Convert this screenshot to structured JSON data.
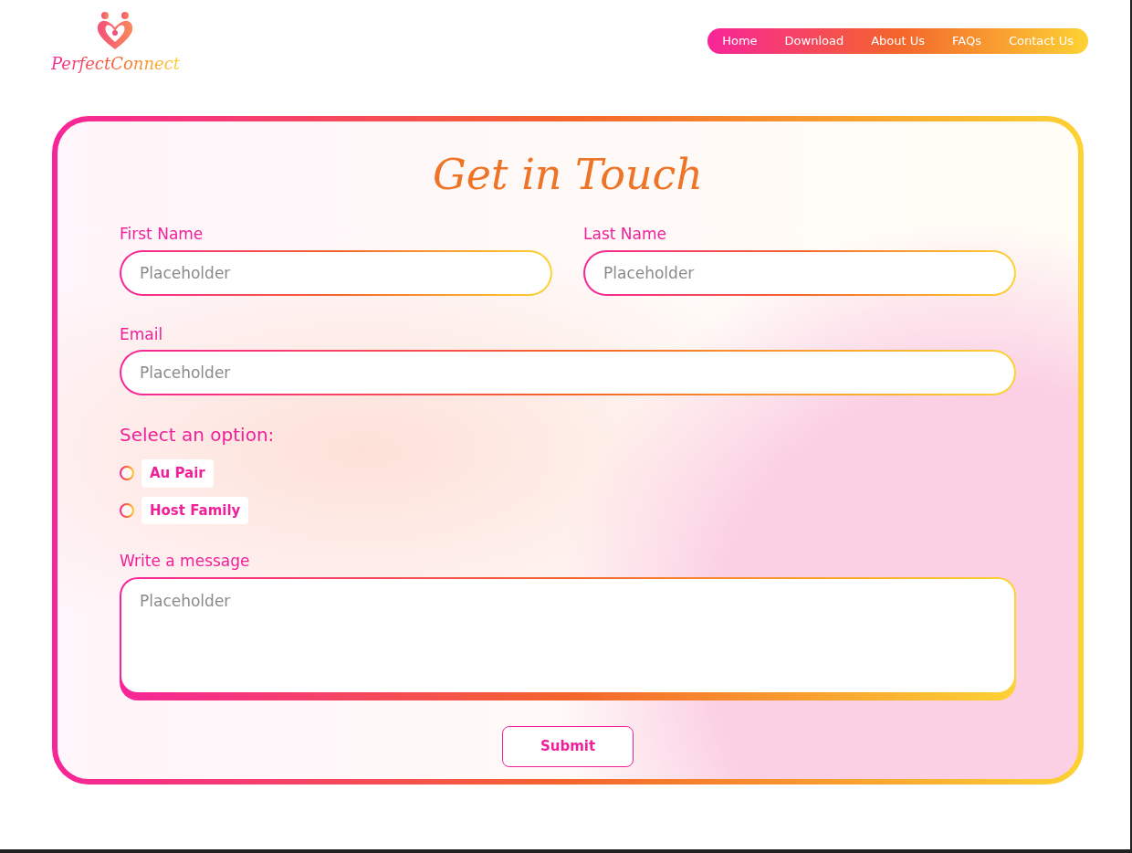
{
  "logo": {
    "text": "PerfectConnect"
  },
  "nav": [
    {
      "label": "Home"
    },
    {
      "label": "Download"
    },
    {
      "label": "About Us"
    },
    {
      "label": "FAQs"
    },
    {
      "label": "Contact Us"
    }
  ],
  "form": {
    "title": "Get in Touch",
    "name_fields": [
      {
        "label": "First Name",
        "placeholder": "Placeholder"
      },
      {
        "label": "Last Name",
        "placeholder": "Placeholder"
      }
    ],
    "email": {
      "label": "Email",
      "placeholder": "Placeholder"
    },
    "option_label": "Select an option:",
    "options": [
      {
        "label": "Au Pair",
        "selected": false
      },
      {
        "label": "Host Family",
        "selected": false
      }
    ],
    "message": {
      "label": "Write a message",
      "placeholder": "Placeholder"
    },
    "submit": "Submit"
  }
}
